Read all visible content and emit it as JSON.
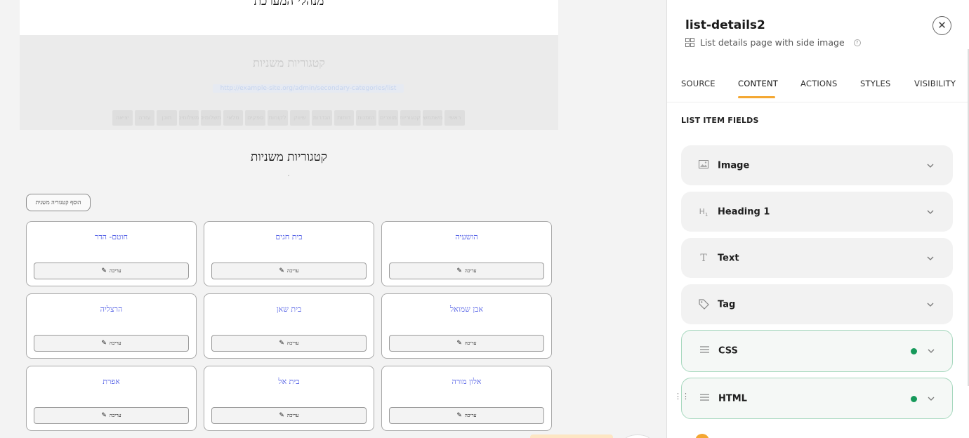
{
  "canvas": {
    "top_title": "מנהלי המערכת",
    "hero": {
      "title": "קטגוריות משניות",
      "link": "http://example-site.org/admin/secondary-categories/list",
      "tabs": [
        "ראשי",
        "משתמשים",
        "קטגוריות",
        "מוצרים",
        "הזמנות",
        "דוחות",
        "הגדרות",
        "שיווק",
        "לקוחות",
        "ספקים",
        "מלאי",
        "תשלומים",
        "משלוחים",
        "תוכן",
        "עזרה",
        "יציאה"
      ]
    },
    "section_title": "קטגוריות משניות",
    "add_button": "הוסף קטגוריה משנית",
    "edit_label": "עריכה",
    "cards": [
      {
        "name": "הושעיה"
      },
      {
        "name": "בית חגים"
      },
      {
        "name": "חוטם- הדר"
      },
      {
        "name": "אבן שמואל"
      },
      {
        "name": "בית שאן"
      },
      {
        "name": "הרצליה"
      },
      {
        "name": "אלון מורה"
      },
      {
        "name": "בית אל"
      },
      {
        "name": "אפרת"
      }
    ]
  },
  "panel": {
    "title": "list-details2",
    "subtitle": "List details page with side image",
    "tabs": [
      "SOURCE",
      "CONTENT",
      "ACTIONS",
      "STYLES",
      "VISIBILITY"
    ],
    "active_tab": "CONTENT",
    "section_label": "LIST ITEM FIELDS",
    "fields": [
      {
        "label": "Image",
        "icon": "image-icon",
        "configured": false
      },
      {
        "label": "Heading 1",
        "icon": "heading-icon",
        "configured": false
      },
      {
        "label": "Text",
        "icon": "text-icon",
        "configured": false
      },
      {
        "label": "Tag",
        "icon": "tag-icon",
        "configured": false
      },
      {
        "label": "CSS",
        "icon": "lines-icon",
        "configured": true
      },
      {
        "label": "HTML",
        "icon": "lines-icon",
        "configured": true
      }
    ],
    "colors": {
      "accent": "#f4a732",
      "configured_dot": "#16995a",
      "link": "#5663e6"
    }
  }
}
